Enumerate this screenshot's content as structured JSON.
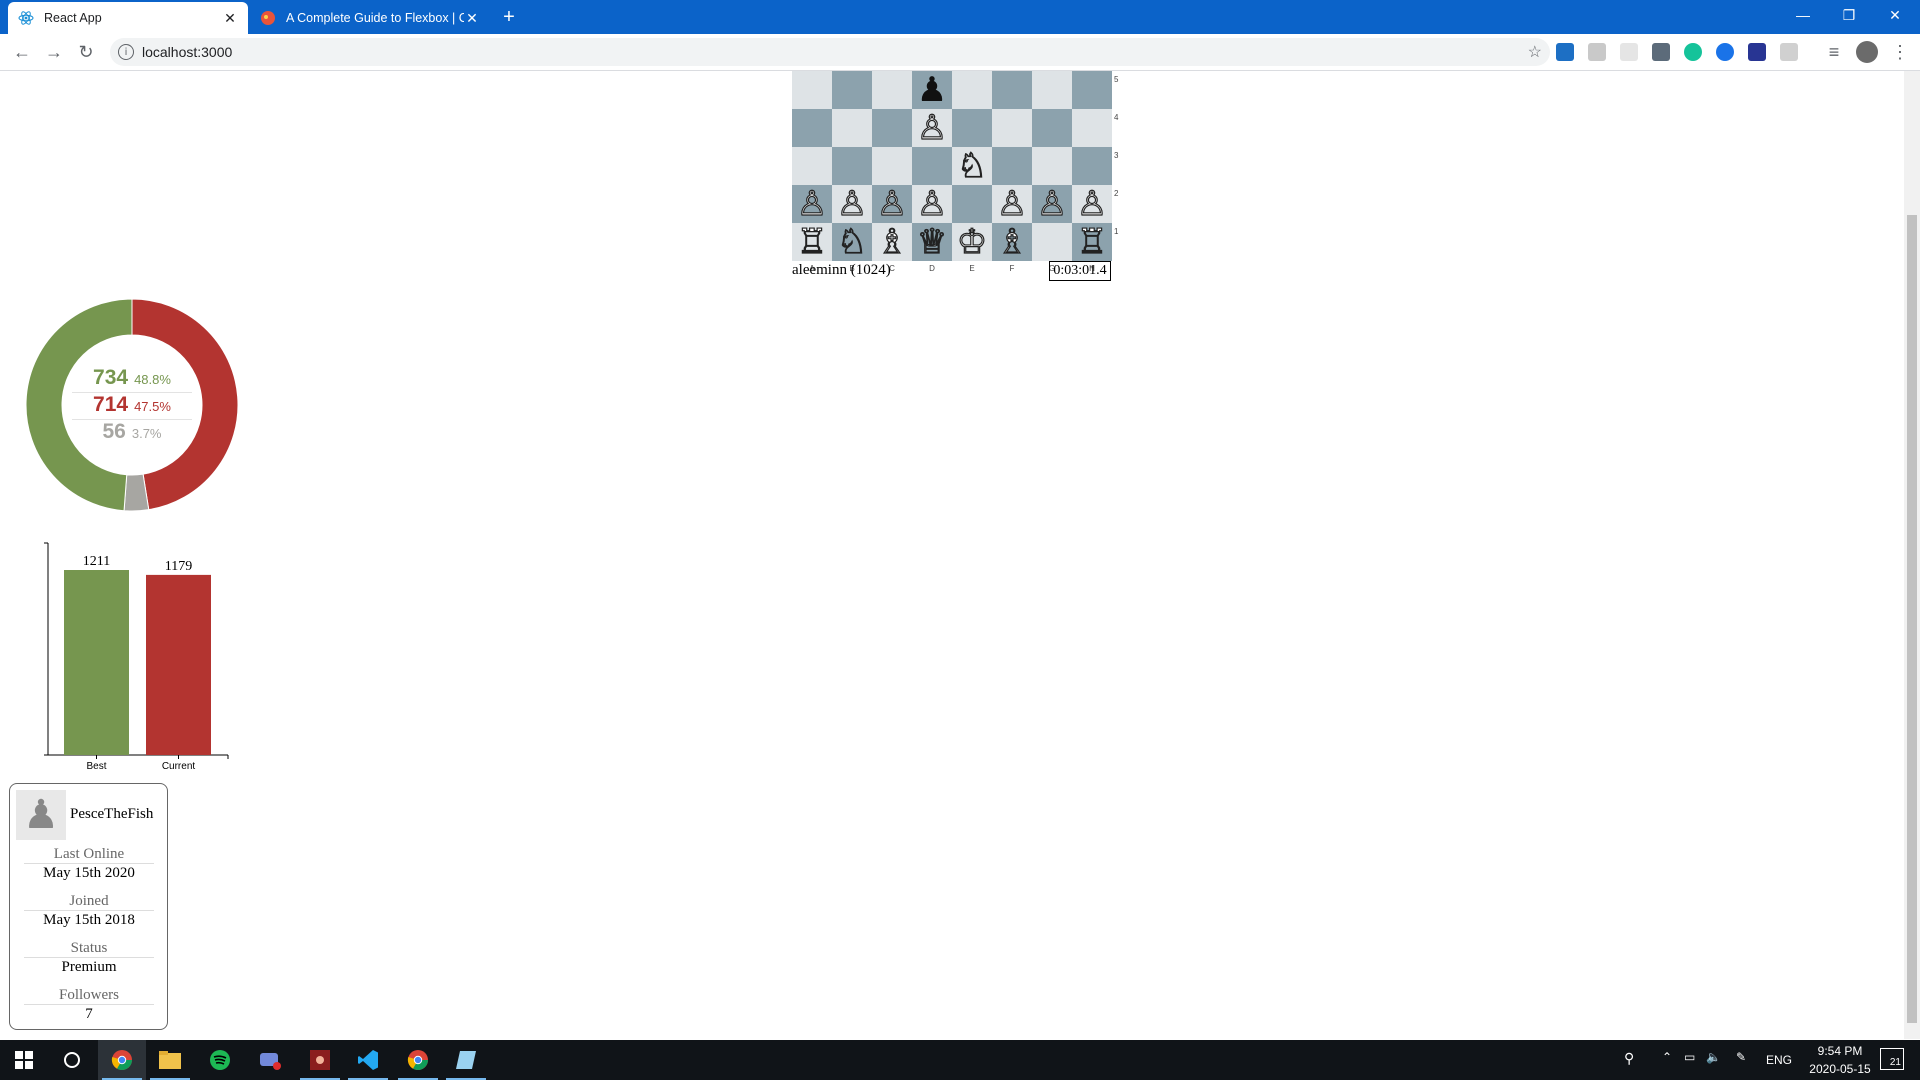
{
  "browser": {
    "tabs": [
      {
        "title": "React App",
        "icon": "react-icon",
        "active": true
      },
      {
        "title": "A Complete Guide to Flexbox | C",
        "icon": "css-tricks-icon",
        "active": false
      }
    ],
    "url": "localhost:3000"
  },
  "game": {
    "board": [
      [
        "",
        "",
        "",
        "♟",
        "",
        "",
        ""
      ],
      [
        "",
        "",
        "",
        "♙",
        "",
        "",
        ""
      ],
      [
        "",
        "",
        "",
        "",
        "♘",
        "",
        ""
      ],
      [
        "♙",
        "♙",
        "♙",
        "♙",
        "",
        "♙",
        "♙",
        "♙"
      ],
      [
        "♖",
        "♘",
        "♗",
        "♕",
        "♔",
        "♗",
        "",
        "♖"
      ]
    ],
    "ranks": [
      "5",
      "4",
      "3",
      "2",
      "1"
    ],
    "files": [
      "A",
      "B",
      "C",
      "D",
      "E",
      "F",
      "G",
      "H"
    ],
    "player": "aleeminn (1024)",
    "clock": "0:03:01.4"
  },
  "stats": {
    "wins": {
      "count": "734",
      "pct": "48.8%"
    },
    "losses": {
      "count": "714",
      "pct": "47.5%"
    },
    "draws": {
      "count": "56",
      "pct": "3.7%"
    },
    "colors": {
      "wins": "#76964f",
      "losses": "#b33430",
      "draws": "#a7a6a2"
    }
  },
  "chart_data": {
    "type": "bar",
    "categories": [
      "Best",
      "Current"
    ],
    "values": [
      1211,
      1179
    ],
    "colors": [
      "#76964f",
      "#b33430"
    ]
  },
  "profile": {
    "username": "PesceTheFish",
    "fields": [
      {
        "label": "Last Online",
        "value": "May 15th 2020"
      },
      {
        "label": "Joined",
        "value": "May 15th 2018"
      },
      {
        "label": "Status",
        "value": "Premium"
      },
      {
        "label": "Followers",
        "value": "7"
      }
    ]
  },
  "taskbar": {
    "language": "ENG",
    "time": "9:54 PM",
    "date": "2020-05-15",
    "notifications": "21"
  }
}
